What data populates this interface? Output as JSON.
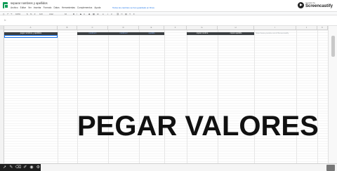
{
  "header": {
    "doc_title": "separar nombres y apellidos",
    "menu": [
      "Archivo",
      "Editar",
      "Ver",
      "Insertar",
      "Formato",
      "Datos",
      "Herramientas",
      "Complementos",
      "Ayuda"
    ],
    "save_status": "Todos los cambios se han guardado en Drive"
  },
  "watermark": {
    "small": "created by",
    "brand": "Screencastify"
  },
  "toolbar": {
    "zoom": "100%",
    "currency": "$",
    "percent": "%",
    "decimals": ".0",
    "format": "123",
    "font": "Arial",
    "size": "10"
  },
  "formula": {
    "fx": "fx",
    "value": ""
  },
  "columns": [
    "A",
    "B",
    "C",
    "D",
    "E",
    "F",
    "G",
    "H",
    "I",
    "J",
    "K"
  ],
  "header_cells": {
    "a": "pegar nombres y apellidos",
    "c": "nombre 1",
    "d": "nombre 2",
    "e": "apellido",
    "g": "copiar nombre",
    "h": "copiar apellido",
    "link": "https://www.youtube.com/c/Screencastify"
  },
  "overlay": "PEGAR VALORES",
  "colors": {
    "header_dark": "#3c4043",
    "accent_blue": "#1a73e8",
    "sheets_green": "#0f9d58"
  }
}
